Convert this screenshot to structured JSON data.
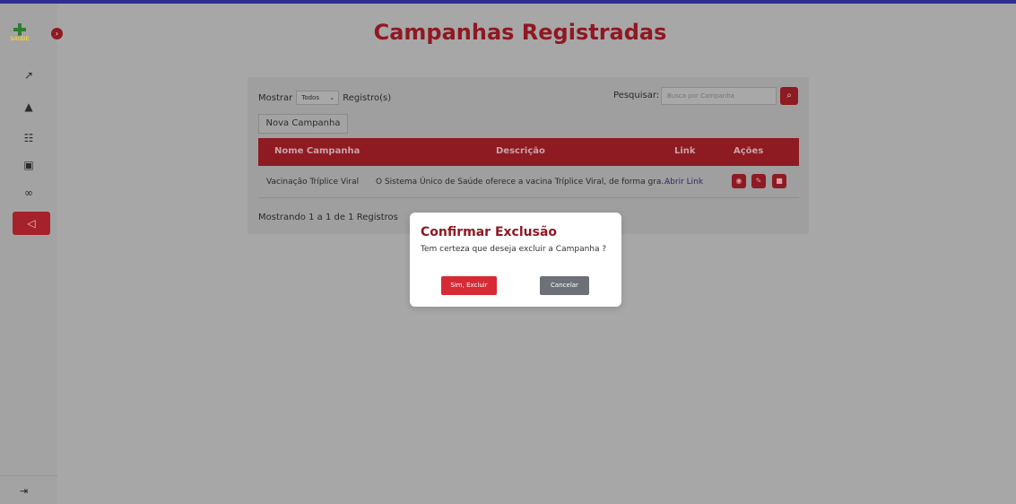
{
  "app": {
    "logo_text": "SAÚDE"
  },
  "sidebar": {
    "items": [
      {
        "icon": "chart-line-icon",
        "glyph": "📈"
      },
      {
        "icon": "user-icon",
        "glyph": "👤"
      },
      {
        "icon": "hospital-icon",
        "glyph": "🏥"
      },
      {
        "icon": "briefcase-medical-icon",
        "glyph": "💼"
      },
      {
        "icon": "binoculars-icon",
        "glyph": "🔭"
      },
      {
        "icon": "bullhorn-icon",
        "glyph": "📢",
        "active": true
      }
    ],
    "logout_icon": "sign-out-icon"
  },
  "header": {
    "title": "Campanhas Registradas"
  },
  "toolbar": {
    "show_label": "Mostrar",
    "show_value": "Todos",
    "records_label": "Registro(s)",
    "search_label": "Pesquisar:",
    "search_placeholder": "Busca por Campanha",
    "new_button": "Nova Campanha"
  },
  "table": {
    "columns": [
      "Nome Campanha",
      "Descrição",
      "Link",
      "Ações"
    ],
    "rows": [
      {
        "name": "Vacinação Tríplice Viral",
        "description": "O Sistema Único de Saúde oferece a vacina Tríplice Viral, de forma gra...",
        "link": "Abrir Link"
      }
    ]
  },
  "footer": {
    "summary": "Mostrando 1 a 1 de 1 Registros"
  },
  "modal": {
    "title": "Confirmar Exclusão",
    "message": "Tem certeza que deseja excluir a Campanha ?",
    "confirm": "Sim, Excluir",
    "cancel": "Cancelar"
  },
  "colors": {
    "brand": "#8f1822",
    "danger": "#d62b35",
    "secondary": "#6d7177"
  }
}
